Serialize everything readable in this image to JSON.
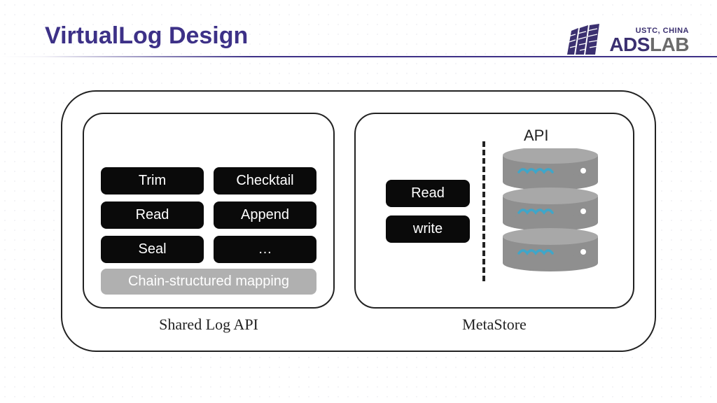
{
  "title": "VirtualLog Design",
  "logo": {
    "top": "USTC, CHINA",
    "ads": "ADS",
    "lab": "LAB"
  },
  "shared_log": {
    "buttons": [
      "Trim",
      "Checktail",
      "Read",
      "Append",
      "Seal",
      "…"
    ],
    "chain_bar": "Chain-structured mapping",
    "label": "Shared Log API"
  },
  "metastore": {
    "api_label": "API",
    "buttons": [
      "Read",
      "write"
    ],
    "label": "MetaStore"
  }
}
